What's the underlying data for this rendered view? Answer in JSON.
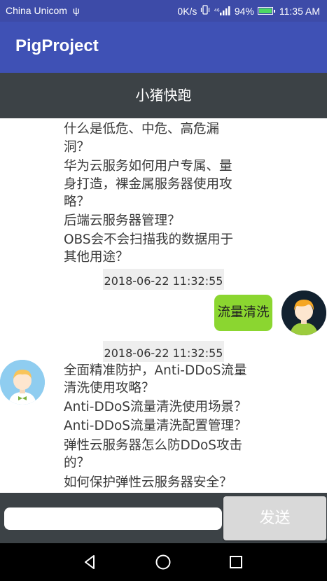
{
  "status_bar": {
    "carrier": "China Unicom",
    "usb": "ψ",
    "speed": "0K/s",
    "signal": "⁴⁶",
    "battery": "94%",
    "time": "11:35 AM"
  },
  "app_bar": {
    "title": "PigProject"
  },
  "chat_header": {
    "title": "小猪快跑"
  },
  "messages": {
    "bot_block_1": [
      "什么是低危、中危、高危漏",
      "洞？",
      "华为云服务如何用户专属、量",
      "身打造，裸金属服务器使用攻",
      "略？",
      "后端云服务器管理？",
      "OBS会不会扫描我的数据用于",
      "其他用途？"
    ],
    "timestamp_1": "2018-06-22  11:32:55",
    "user_message": "流量清洗",
    "timestamp_2": "2018-06-22  11:32:55",
    "bot_block_2": [
      "全面精准防护，Anti-DDoS流量",
      "清洗使用攻略？",
      "Anti-DDoS流量清洗使用场景？",
      "Anti-DDoS流量清洗配置管理？",
      "弹性云服务器怎么防DDoS攻击",
      "的？",
      "如何保护弹性云服务器安全？"
    ]
  },
  "input_bar": {
    "value": "",
    "placeholder": "",
    "send_label": "发送"
  },
  "colors": {
    "status_bar": "#3d4ba8",
    "app_bar": "#3f51b5",
    "header": "#3c4246",
    "bubble": "#8bd630",
    "send_button": "#d9d9d9"
  },
  "icons": [
    "usb-icon",
    "vibrate-icon",
    "signal-icon",
    "battery-icon",
    "back-icon",
    "home-icon",
    "recents-icon"
  ]
}
